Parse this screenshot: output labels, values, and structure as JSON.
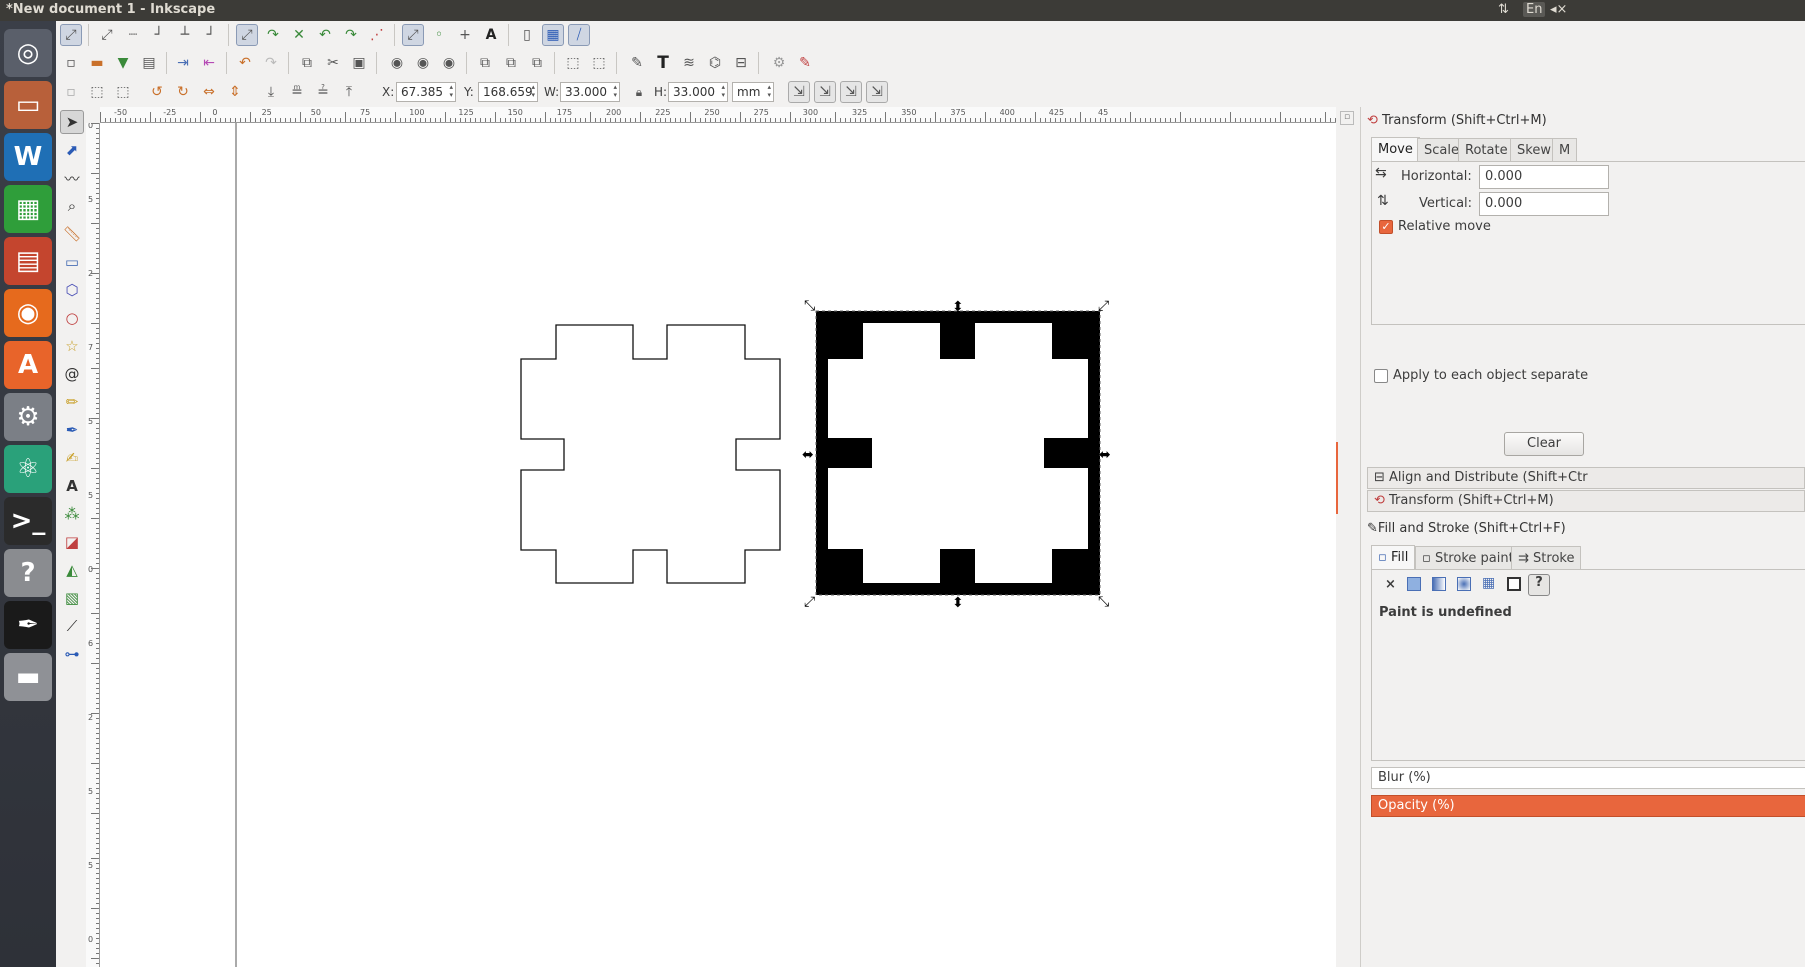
{
  "window": {
    "title": "*New document 1 - Inkscape",
    "keyboard_indicator": "En"
  },
  "launcher": [
    {
      "name": "dash",
      "glyph": "◎",
      "color": "#5a5f6a"
    },
    {
      "name": "files",
      "glyph": "▭",
      "color": "#b8603a"
    },
    {
      "name": "writer",
      "glyph": "W",
      "color": "#1f6fb5"
    },
    {
      "name": "calc",
      "glyph": "▦",
      "color": "#2f9e3a"
    },
    {
      "name": "impress",
      "glyph": "▤",
      "color": "#c4452e"
    },
    {
      "name": "firefox",
      "glyph": "◉",
      "color": "#e66a1d"
    },
    {
      "name": "software-center",
      "glyph": "A",
      "color": "#e8642a"
    },
    {
      "name": "system-settings",
      "glyph": "⚙",
      "color": "#7b7f86"
    },
    {
      "name": "atom",
      "glyph": "⚛",
      "color": "#2aa17a"
    },
    {
      "name": "terminal",
      "glyph": ">_",
      "color": "#2b2b2b"
    },
    {
      "name": "help",
      "glyph": "?",
      "color": "#8a8c90"
    },
    {
      "name": "inkscape",
      "glyph": "✒",
      "color": "#1a1a1a"
    },
    {
      "name": "drive",
      "glyph": "▬",
      "color": "#8f9196"
    }
  ],
  "toolbar": {
    "x_label": "X:",
    "x_value": "67.385",
    "y_label": "Y:",
    "y_value": "168.659",
    "w_label": "W:",
    "w_value": "33.000",
    "h_label": "H:",
    "h_value": "33.000",
    "unit": "mm"
  },
  "ruler_top": [
    "-50",
    "-25",
    "0",
    "25",
    "50",
    "75",
    "100",
    "125",
    "150",
    "175",
    "200",
    "225",
    "250",
    "275",
    "300",
    "325",
    "350",
    "375",
    "400",
    "425",
    "45"
  ],
  "ruler_left": [
    "0",
    "5",
    "2",
    "7",
    "5",
    "5",
    "0",
    "6",
    "2",
    "5",
    "5",
    "0"
  ],
  "dock": {
    "transform_title": "Transform (Shift+Ctrl+M)",
    "tabs": [
      "Move",
      "Scale",
      "Rotate",
      "Skew",
      "M"
    ],
    "horizontal_label": "Horizontal:",
    "horizontal_value": "0.000",
    "vertical_label": "Vertical:",
    "vertical_value": "0.000",
    "relative_move": "Relative move",
    "apply_each": "Apply to each object separate",
    "clear_button": "Clear",
    "align_title": "Align and Distribute (Shift+Ctr",
    "transform_title2": "Transform (Shift+Ctrl+M)",
    "fill_stroke_title": "Fill and Stroke (Shift+Ctrl+F)",
    "fill_tabs": [
      "Fill",
      "Stroke paint",
      "Stroke"
    ],
    "paint_status": "Paint is undefined",
    "blur_label": "Blur (%)",
    "opacity_label": "Opacity (%)"
  }
}
